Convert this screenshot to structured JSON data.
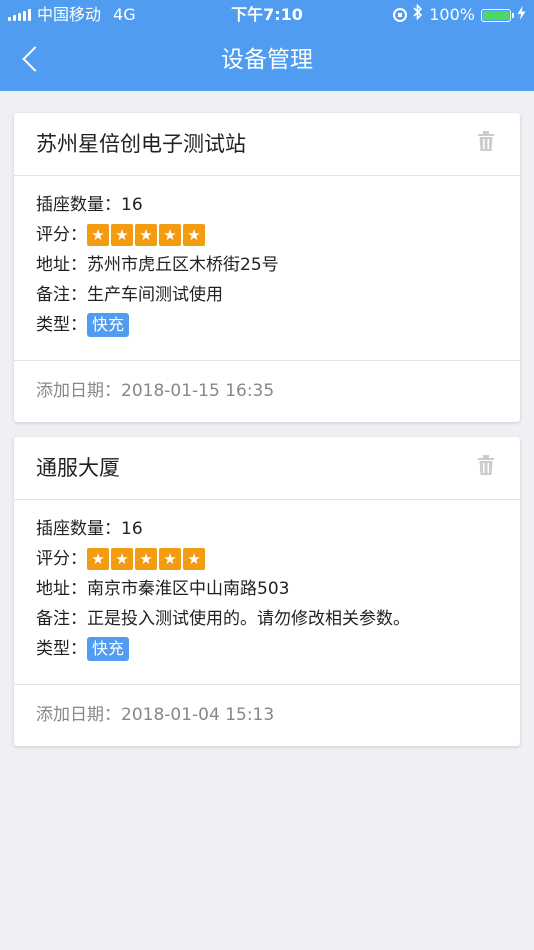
{
  "status_bar": {
    "carrier": "中国移动",
    "network": "4G",
    "time": "下午7:10",
    "battery": "100%",
    "battery_level": 1.0
  },
  "nav": {
    "title": "设备管理"
  },
  "labels": {
    "sockets": "插座数量：",
    "rating": "评分：",
    "address": "地址：",
    "note": "备注：",
    "type": "类型：",
    "date": "添加日期："
  },
  "devices": [
    {
      "name": "苏州星倍创电子测试站",
      "sockets": "16",
      "rating": 5,
      "address": "苏州市虎丘区木桥街25号",
      "note": "生产车间测试使用",
      "type": "快充",
      "date": "2018-01-15 16:35"
    },
    {
      "name": "通服大厦",
      "sockets": "16",
      "rating": 5,
      "address": "南京市秦淮区中山南路503",
      "note": "正是投入测试使用的。请勿修改相关参数。",
      "type": "快充",
      "date": "2018-01-04 15:13"
    }
  ],
  "colors": {
    "nav_bg": "#4f9cf0",
    "star": "#f39c12",
    "tag_bg": "#4f9cf0",
    "page_bg": "#efeff4"
  },
  "icons": {
    "back": "chevron-left-icon",
    "delete": "trash-icon",
    "star": "star-icon"
  }
}
